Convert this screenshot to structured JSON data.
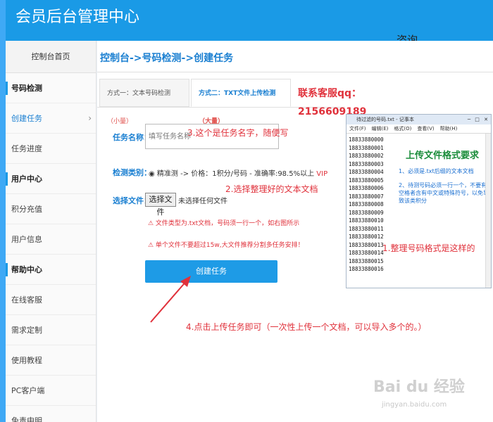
{
  "header": {
    "title": "会员后台管理中心",
    "consult": "咨询"
  },
  "sidebar": {
    "home": "控制台首页",
    "items": [
      {
        "label": "号码检测",
        "type": "section"
      },
      {
        "label": "创建任务",
        "type": "active",
        "chevron": "›"
      },
      {
        "label": "任务进度",
        "type": "item"
      },
      {
        "label": "用户中心",
        "type": "section"
      },
      {
        "label": "积分充值",
        "type": "item"
      },
      {
        "label": "用户信息",
        "type": "item"
      },
      {
        "label": "帮助中心",
        "type": "section"
      },
      {
        "label": "在线客服",
        "type": "item"
      },
      {
        "label": "需求定制",
        "type": "item"
      },
      {
        "label": "使用教程",
        "type": "item"
      },
      {
        "label": "PC客户端",
        "type": "item"
      },
      {
        "label": "免责申明",
        "type": "item"
      }
    ]
  },
  "main": {
    "breadcrumb": "控制台->号码检测->创建任务",
    "tabs": [
      {
        "label": "方式一：文本号码检测",
        "badge": "（小量）"
      },
      {
        "label": "方式二：TXT文件上传检测",
        "badge": "（大量）"
      }
    ],
    "contact": {
      "line1": "联系客服qq：",
      "line2": "2156609189"
    },
    "task_name_label": "任务名称：",
    "task_name_placeholder": "填写任务名称",
    "detect_type_label": "检测类别：",
    "detect_type_text": "◉ 精准测 -> 价格：1积分/号码 - 准确率:98.5%以上",
    "detect_type_vip": "VIP",
    "file_label": "选择文件：",
    "file_button": "选择文件",
    "file_status": "未选择任何文件",
    "warning1": "⚠ 文件类型为.txt文档，号码须一行一个，如右图所示",
    "warning2": "⚠ 单个文件不要超过15w,大文件推荐分割多任务安排！",
    "submit_label": "创建任务"
  },
  "annotations": {
    "a1": "3.这个是任务名字，随便写",
    "a2": "2.选择整理好的文本文档",
    "a3": "1.整理号码格式是这样的",
    "a4": "4.点击上传任务即可（一次性上传一个文档，可以导入多个的。）"
  },
  "notepad": {
    "title": "待过滤的号码.txt - 记事本",
    "window_buttons": "─ □ ✕",
    "menu": [
      "文件(F)",
      "编辑(E)",
      "格式(O)",
      "查看(V)",
      "帮助(H)"
    ],
    "numbers": [
      "18833880000",
      "18833880001",
      "18833880002",
      "18833880003",
      "18833880004",
      "18833880005",
      "18833880006",
      "18833880007",
      "18833880008",
      "18833880009",
      "18833880010",
      "18833880011",
      "18833880012",
      "18833880013",
      "18833880014",
      "18833880015",
      "18833880016"
    ],
    "heading": "上传文件格式要求",
    "rule1": "1、必须是.txt后缀的文本文档",
    "rule2": "2、待测号码必须一行一个，不要有空格者含有中文或特殊符号，以免导致该类积分"
  },
  "watermark": {
    "main": "Bai du 经验",
    "sub": "jingyan.baidu.com"
  },
  "colors": {
    "header": "#1a9ae6",
    "accent": "#1a7fd1",
    "annotation": "#e0313b",
    "button": "#1e9be6"
  }
}
